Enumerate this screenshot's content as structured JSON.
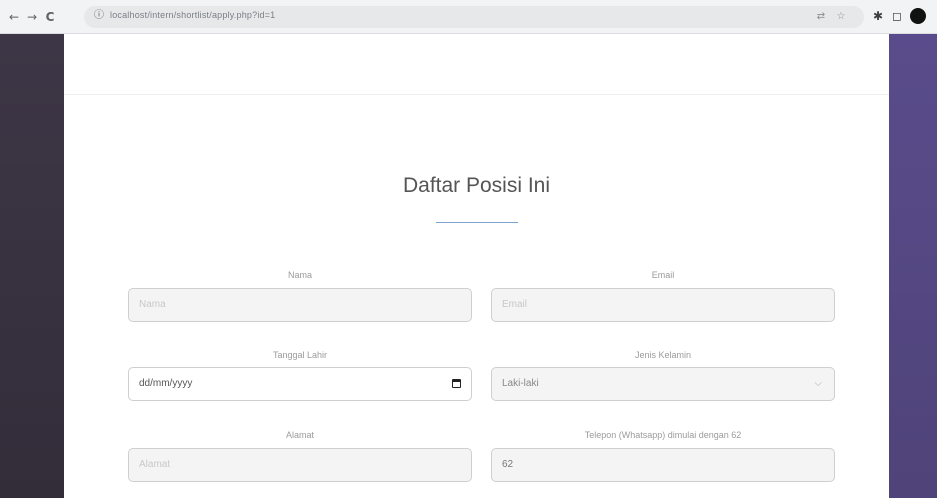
{
  "browser": {
    "url": "localhost/intern/shortlist/apply.php?id=1",
    "nav": {
      "back": "←",
      "forward": "→",
      "reload": "C"
    },
    "info_icon": "ⓘ",
    "omnibox_icons": [
      "⇄",
      "☆"
    ],
    "toolbar_icons": [
      "✱",
      "◻"
    ]
  },
  "page": {
    "title": "Daftar Posisi Ini"
  },
  "form": {
    "nama": {
      "label": "Nama",
      "placeholder": "Nama"
    },
    "email": {
      "label": "Email",
      "placeholder": "Email"
    },
    "tanggal_lahir": {
      "label": "Tanggal Lahir",
      "value": "dd/mm/yyyy"
    },
    "jenis_kelamin": {
      "label": "Jenis Kelamin",
      "value": "Laki-laki"
    },
    "alamat": {
      "label": "Alamat",
      "placeholder": "Alamat"
    },
    "telepon": {
      "label": "Telepon (Whatsapp) dimulai dengan 62",
      "value": "62"
    }
  },
  "colors": {
    "sidebar_left": "#3a3342",
    "sidebar_right": "#574a85",
    "accent_rule": "#7fa3cf"
  }
}
